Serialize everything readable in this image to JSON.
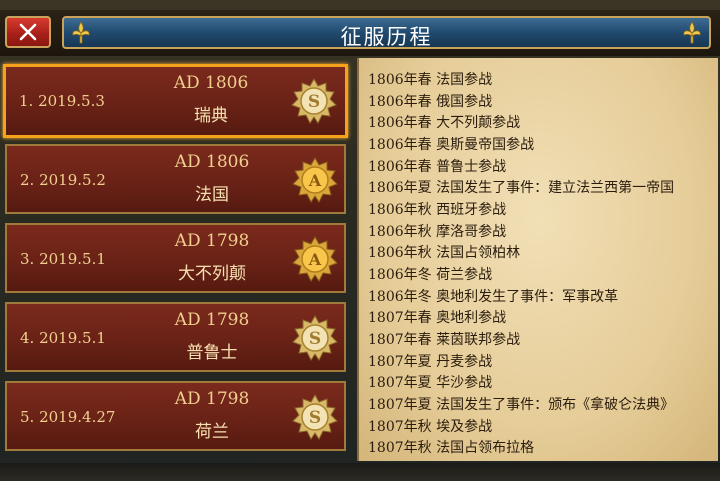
{
  "title": "征服历程",
  "close_icon": "close-icon",
  "entries": [
    {
      "date": "1. 2019.5.3",
      "year": "AD 1806",
      "nation": "瑞典",
      "rank": "S",
      "selected": true
    },
    {
      "date": "2. 2019.5.2",
      "year": "AD 1806",
      "nation": "法国",
      "rank": "A",
      "selected": false
    },
    {
      "date": "3. 2019.5.1",
      "year": "AD 1798",
      "nation": "大不列颠",
      "rank": "A",
      "selected": false
    },
    {
      "date": "4. 2019.5.1",
      "year": "AD 1798",
      "nation": "普鲁士",
      "rank": "S",
      "selected": false
    },
    {
      "date": "5. 2019.4.27",
      "year": "AD 1798",
      "nation": "荷兰",
      "rank": "S",
      "selected": false
    }
  ],
  "log": [
    "1806年春  法国参战",
    "1806年春  俄国参战",
    "1806年春  大不列颠参战",
    "1806年春  奥斯曼帝国参战",
    "1806年春  普鲁士参战",
    "1806年夏  法国发生了事件：建立法兰西第一帝国",
    "1806年秋  西班牙参战",
    "1806年秋  摩洛哥参战",
    "1806年秋  法国占领柏林",
    "1806年冬  荷兰参战",
    "1806年冬  奥地利发生了事件：军事改革",
    "1807年春  奥地利参战",
    "1807年春  莱茵联邦参战",
    "1807年夏  丹麦参战",
    "1807年夏  华沙参战",
    "1807年夏  法国发生了事件：颁布《拿破仑法典》",
    "1807年秋  埃及参战",
    "1807年秋  法国占领布拉格"
  ],
  "colors": {
    "title_bar": "#214a6f",
    "entry_bg": "#6a2216",
    "selected_border": "#f6a21a",
    "close_button": "#c3271f",
    "parchment": "#e6cd99"
  }
}
